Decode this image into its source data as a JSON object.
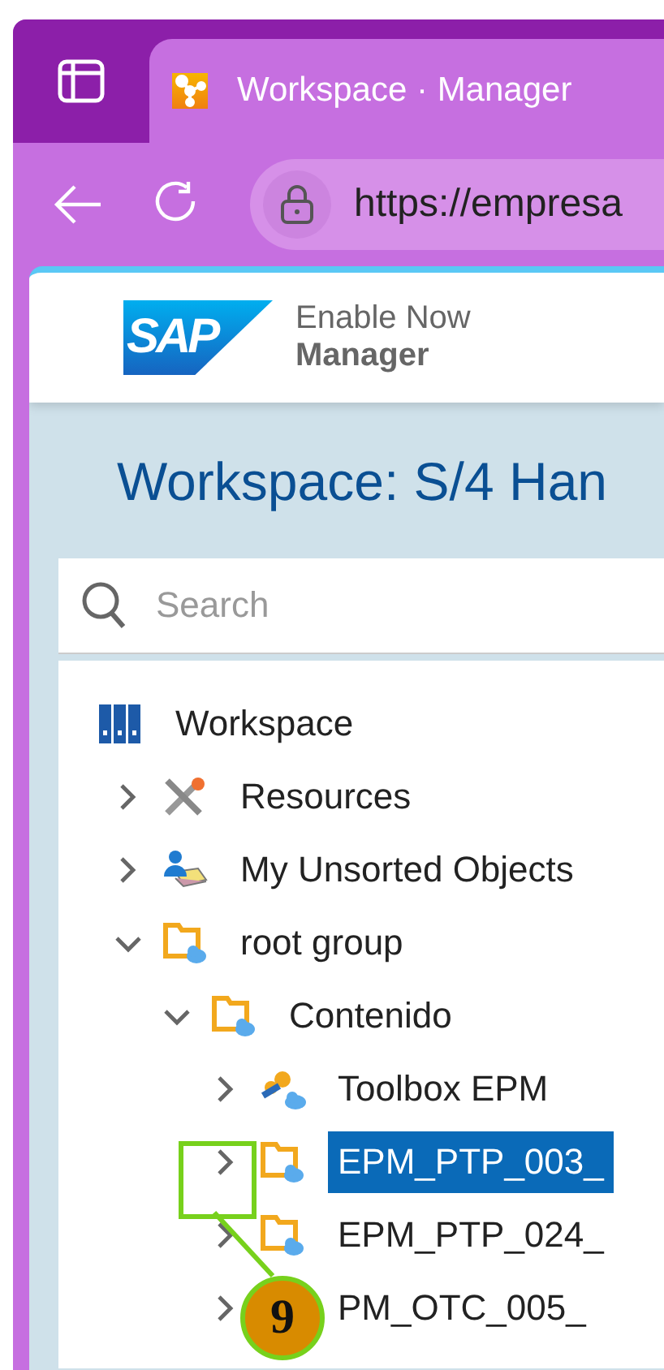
{
  "browser": {
    "tab_title": "Workspace · Manager",
    "url": "https://empresa"
  },
  "header": {
    "brand": "SAP",
    "product_line1": "Enable Now",
    "product_line2": "Manager"
  },
  "page_title": "Workspace: S/4 Han",
  "search": {
    "placeholder": "Search"
  },
  "tree": [
    {
      "label": "Workspace",
      "kind": "workspace",
      "selected": false,
      "children": [
        {
          "label": "Resources",
          "kind": "resources",
          "expanded": false,
          "selected": false
        },
        {
          "label": "My Unsorted Objects",
          "kind": "unsorted",
          "expanded": false,
          "selected": false
        },
        {
          "label": "root group",
          "kind": "group",
          "expanded": true,
          "selected": false,
          "children": [
            {
              "label": "Contenido",
              "kind": "group",
              "expanded": true,
              "selected": false,
              "children": [
                {
                  "label": "Toolbox EPM",
                  "kind": "toolbox",
                  "expanded": false,
                  "selected": false
                },
                {
                  "label": "EPM_PTP_003_",
                  "kind": "group",
                  "expanded": false,
                  "selected": true
                },
                {
                  "label": "EPM_PTP_024_",
                  "kind": "group",
                  "expanded": false,
                  "selected": false
                },
                {
                  "label": "PM_OTC_005_",
                  "kind": "group",
                  "expanded": false,
                  "selected": false
                }
              ]
            }
          ]
        }
      ]
    }
  ],
  "callout": {
    "number": "9"
  }
}
